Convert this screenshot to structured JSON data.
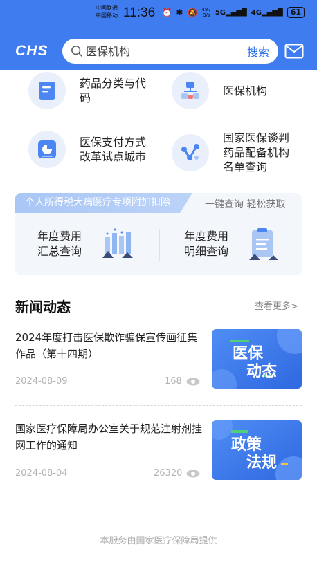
{
  "status_bar": {
    "carrier_1": "中国联通",
    "carrier_2": "中国移动",
    "time": "11:36",
    "net_speed_value": "487",
    "net_speed_unit": "B/s",
    "signal_1": "5G",
    "signal_2": "4G",
    "battery": "61"
  },
  "header": {
    "logo": "CHS",
    "search_placeholder": "医保机构",
    "search_button": "搜索"
  },
  "tiles": [
    {
      "label_line1": "药品分类与代",
      "label_line2": "码",
      "label_line3": "",
      "icon": "document-icon"
    },
    {
      "label_line1": "医保机构",
      "label_line2": "",
      "label_line3": "",
      "icon": "org-chart-icon"
    },
    {
      "label_line1": "医保支付方式",
      "label_line2": "改革试点城市",
      "label_line3": "",
      "icon": "pie-card-icon"
    },
    {
      "label_line1": "国家医保谈判",
      "label_line2": "药品配备机构",
      "label_line3": "名单查询",
      "icon": "network-icon"
    }
  ],
  "tax_card": {
    "tag": "个人所得税大病医疗专项附加扣除",
    "slogan": "一键查询 轻松获取",
    "items": [
      {
        "line1": "年度费用",
        "line2": "汇总查询"
      },
      {
        "line1": "年度费用",
        "line2": "明细查询"
      }
    ]
  },
  "news": {
    "title": "新闻动态",
    "more": "查看更多>",
    "items": [
      {
        "title": "2024年度打击医保欺诈骗保宣传画征集作品（第十四期）",
        "date": "2024-08-09",
        "views": "168",
        "thumb_line1": "医保",
        "thumb_line2": "动态"
      },
      {
        "title": "国家医疗保障局办公室关于规范注射剂挂网工作的通知",
        "date": "2024-08-04",
        "views": "26320",
        "thumb_line1": "政策",
        "thumb_line2": "法规"
      }
    ]
  },
  "footer": "本服务由国家医疗保障局提供",
  "colors": {
    "brand_blue": "#3f7cf0",
    "link_blue": "#2a6de8",
    "tag_blue": "#a9c6f5",
    "accent_green": "#4fcf7a"
  }
}
